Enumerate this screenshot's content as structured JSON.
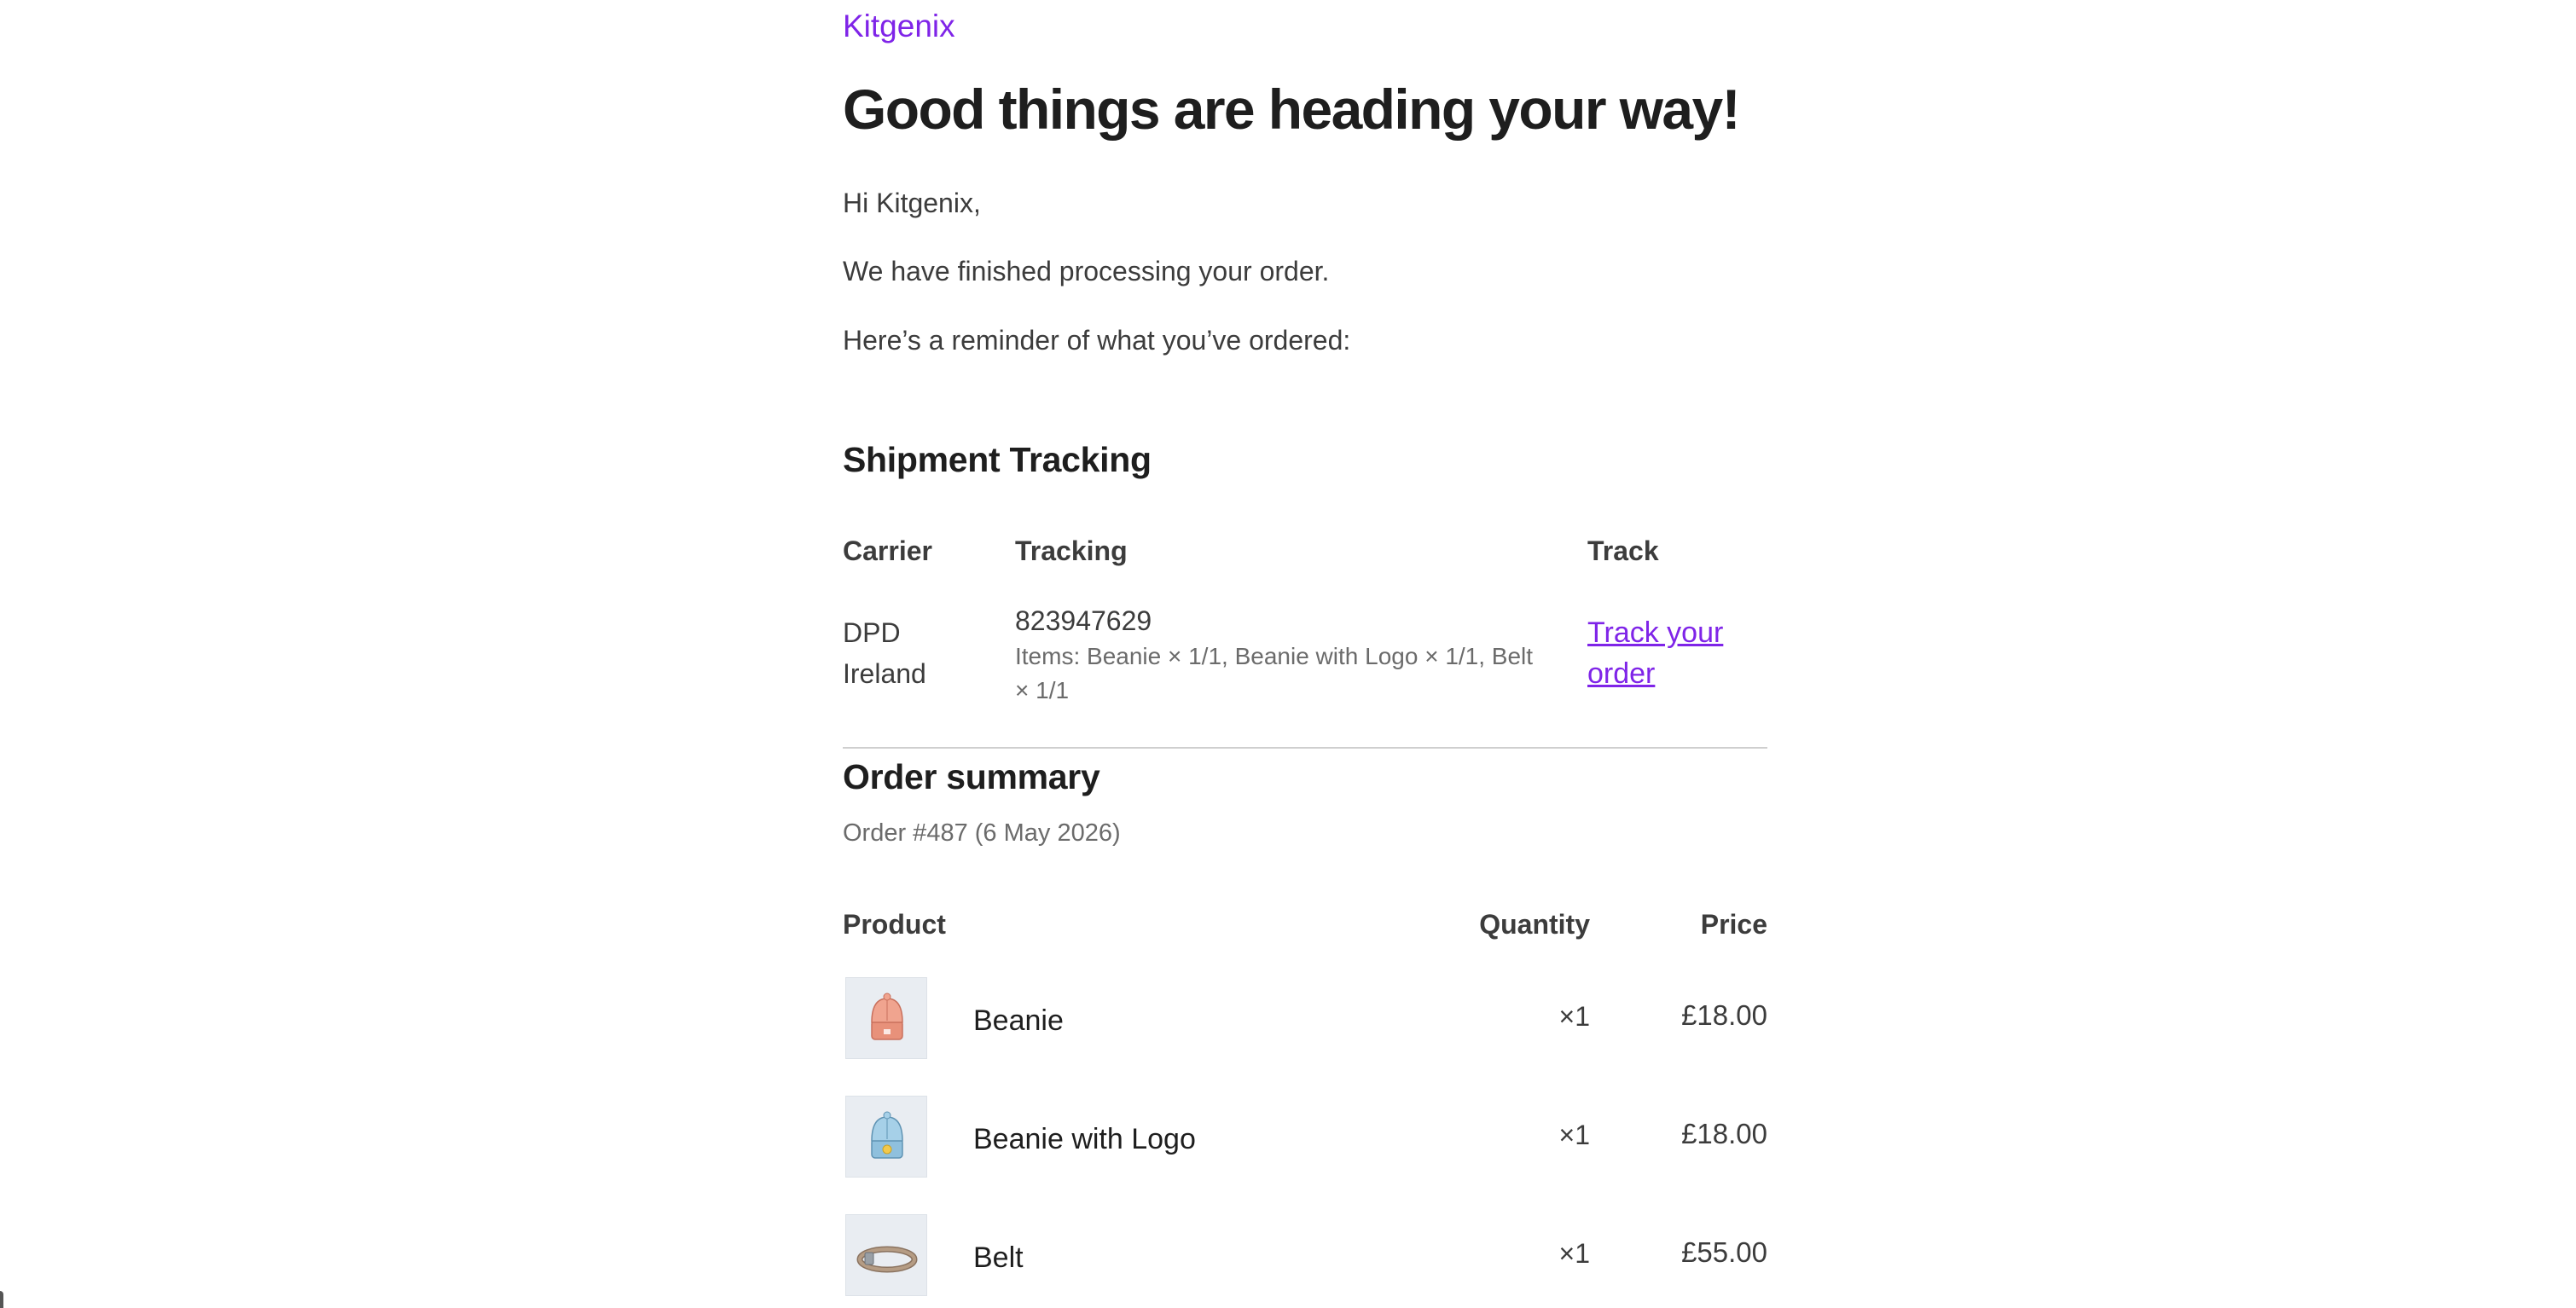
{
  "brand": "Kitgenix",
  "heading": "Good things are heading your way!",
  "greeting": "Hi Kitgenix,",
  "processed": "We have finished processing your order.",
  "reminder": "Here’s a reminder of what you’ve ordered:",
  "shipment": {
    "title": "Shipment Tracking",
    "headers": {
      "carrier": "Carrier",
      "tracking": "Tracking",
      "track": "Track"
    },
    "row": {
      "carrier_line1": "DPD",
      "carrier_line2": "Ireland",
      "tracking_number": "823947629",
      "items_line1": "Items: Beanie × 1/1, Beanie with Logo × 1/1, Belt",
      "items_line2": "× 1/1",
      "link_line1": "Track your",
      "link_line2": "order"
    }
  },
  "summary": {
    "title": "Order summary",
    "order_meta": "Order #487 (6 May 2026)",
    "headers": {
      "product": "Product",
      "quantity": "Quantity",
      "price": "Price"
    },
    "items": [
      {
        "name": "Beanie",
        "quantity": "×1",
        "price": "£18.00",
        "icon": "beanie-icon"
      },
      {
        "name": "Beanie with Logo",
        "quantity": "×1",
        "price": "£18.00",
        "icon": "beanie-logo-icon"
      },
      {
        "name": "Belt",
        "quantity": "×1",
        "price": "£55.00",
        "icon": "belt-icon"
      }
    ]
  },
  "colors": {
    "accent": "#7f24e8",
    "text": "#3c3c3c",
    "heading": "#1e1e1e"
  }
}
